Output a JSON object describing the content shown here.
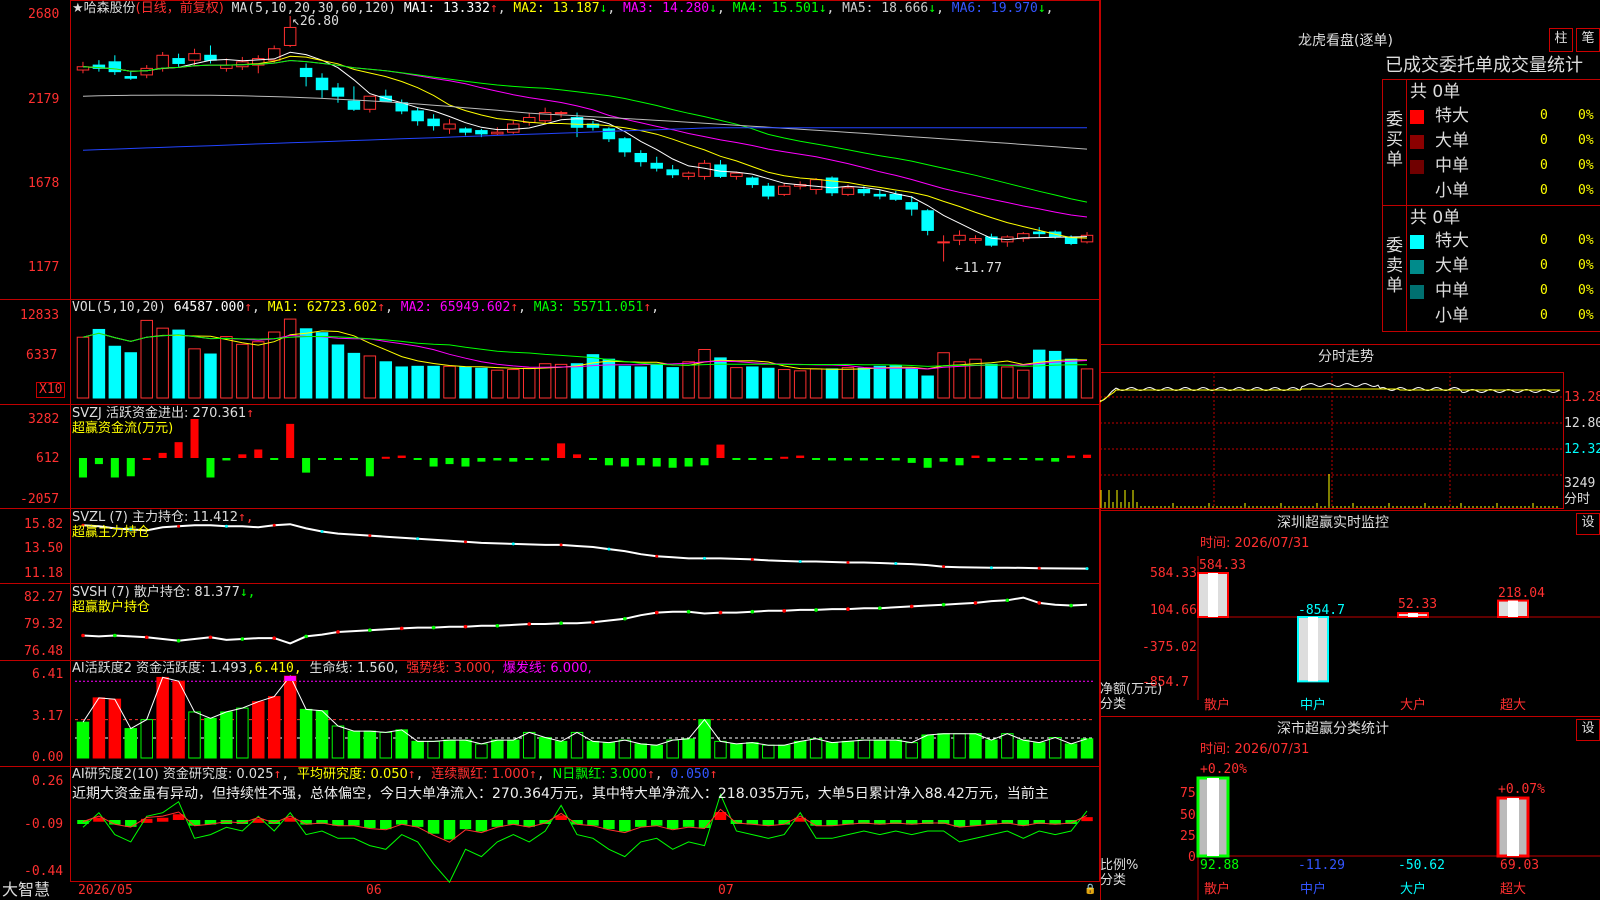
{
  "stock": {
    "star": "★",
    "name": "哈森股份",
    "period": "(日线，前复权)"
  },
  "ma_header": {
    "label": "MA(5,10,20,30,60,120)",
    "items": [
      {
        "t": "MA1: 13.332",
        "a": "↑",
        "c": "#ffffff"
      },
      {
        "t": "MA2: 13.187",
        "a": "↓",
        "c": "#ffff00"
      },
      {
        "t": "MA3: 14.280",
        "a": "↓",
        "c": "#ff00ff"
      },
      {
        "t": "MA4: 15.501",
        "a": "↓",
        "c": "#00ff00"
      },
      {
        "t": "MA5: 18.666",
        "a": "↓",
        "c": "#cccccc"
      },
      {
        "t": "MA6: 19.970",
        "a": "↓",
        "c": "#3355ff"
      }
    ]
  },
  "price_axis": [
    "2680",
    "2179",
    "1678",
    "1177"
  ],
  "price_high_label": "26.80",
  "price_low_label": "11.77",
  "vol_header": {
    "label": "VOL(5,10,20)",
    "value": "64587.000",
    "a": "↑",
    "items": [
      {
        "t": "MA1: 62723.602",
        "a": "↑",
        "c": "#ffff00"
      },
      {
        "t": "MA2: 65949.602",
        "a": "↑",
        "c": "#ff00ff"
      },
      {
        "t": "MA3: 55711.051",
        "a": "↑",
        "c": "#00ff00"
      }
    ]
  },
  "vol_axis": [
    "12833",
    "6337"
  ],
  "vol_unit": "X10",
  "svzj": {
    "label": "SVZJ  活跃资金进出: 270.361",
    "a": "↑",
    "sub": "超赢资金流(万元)",
    "axis": [
      "3282",
      "612",
      "-2057"
    ]
  },
  "svzl": {
    "label": "SVZL (7) 主力持仓: 11.412",
    "a": "↑,",
    "sub": "超赢主力持仓",
    "axis": [
      "15.82",
      "13.50",
      "11.18"
    ]
  },
  "svsh": {
    "label": "SVSH (7) 散户持仓: 81.377",
    "a": "↓,",
    "sub": "超赢散户持仓",
    "axis": [
      "82.27",
      "79.32",
      "76.48"
    ]
  },
  "ai2": {
    "label": "AI活跃度2 资金活跃度: 1.493",
    "l2": ",6.410,",
    "l3": "生命线: 1.560,",
    "l4": "强势线: 3.000,",
    "l5": "爆发线: 6.000,",
    "axis": [
      "6.41",
      "3.17",
      "0.00"
    ]
  },
  "ai_res": {
    "label": "AI研究度2(10) 资金研究度: 0.025",
    "a1": "↑",
    "l2": "平均研究度: 0.050",
    "a2": "↑",
    "l3": "连续飘红: 1.000",
    "a3": "↑",
    "l4": "N日飘红: 3.000",
    "a4": "↑",
    "l5": "0.050",
    "a5": "↑",
    "axis": [
      "0.26",
      "-0.09",
      "-0.44"
    ],
    "text": "近期大资金虽有异动，但持续性不强，总体偏空，今日大单净流入：270.364万元，其中特大单净流入：218.035万元，大单5日累计净入88.42万元，当前主"
  },
  "x_axis": [
    "2026/05",
    "06",
    "07"
  ],
  "brand": "大智慧",
  "lhb": {
    "title": "龙虎看盘(逐单)",
    "tabs": [
      "柱",
      "笔"
    ],
    "subtitle": "已成交委托单成交量统计",
    "buy": {
      "side": "委买单",
      "total": "共 0单",
      "rows": [
        [
          "特大",
          "0",
          "0%"
        ],
        [
          "大单",
          "0",
          "0%"
        ],
        [
          "中单",
          "0",
          "0%"
        ],
        [
          "小单",
          "0",
          "0%"
        ]
      ]
    },
    "sell": {
      "side": "委卖单",
      "total": "共 0单",
      "rows": [
        [
          "特大",
          "0",
          "0%"
        ],
        [
          "大单",
          "0",
          "0%"
        ],
        [
          "中单",
          "0",
          "0%"
        ],
        [
          "小单",
          "0",
          "0%"
        ]
      ]
    }
  },
  "fenshi": {
    "title": "分时走势",
    "axis": [
      "13.28",
      "12.80",
      "12.32",
      "3249"
    ],
    "unit": "分时"
  },
  "sz_monitor": {
    "title": "深圳超赢实时监控",
    "btn": "设",
    "time": "时间: 2026/07/31",
    "axis": [
      "584.33",
      "104.66",
      "-375.02",
      "-854.7"
    ],
    "bar_labels": [
      "584.33",
      "-854.7",
      "52.33",
      "218.04"
    ],
    "ylab": "净额(万元)",
    "xlab": "分类",
    "cats": [
      "散户",
      "中户",
      "大户",
      "超大"
    ]
  },
  "sz_class": {
    "title": "深市超赢分类统计",
    "btn": "设",
    "time": "时间: 2026/07/31",
    "axis": [
      "75",
      "50",
      "25",
      "0"
    ],
    "top_labels": [
      "+0.20%",
      "+0.07%"
    ],
    "vals": [
      "92.88",
      "-11.29",
      "-50.62",
      "69.03"
    ],
    "ylab": "比例%",
    "xlab": "分类",
    "cats": [
      "散户",
      "中户",
      "大户",
      "超大"
    ]
  },
  "chart_data": [
    {
      "type": "candlestick",
      "title": "哈森股份 日线 前复权",
      "ylim": [
        11.77,
        26.8
      ],
      "markers": {
        "high": 26.8,
        "low": 11.77
      },
      "ma_series": [
        {
          "name": "MA1",
          "last": 13.332
        },
        {
          "name": "MA2",
          "last": 13.187
        },
        {
          "name": "MA3",
          "last": 14.28
        },
        {
          "name": "MA4",
          "last": 15.501
        },
        {
          "name": "MA5",
          "last": 18.666
        },
        {
          "name": "MA6",
          "last": 19.97
        }
      ],
      "ohlc": [
        [
          23.5,
          24.0,
          23.3,
          23.7
        ],
        [
          23.8,
          24.1,
          23.4,
          23.6
        ],
        [
          24.0,
          24.4,
          23.2,
          23.4
        ],
        [
          23.1,
          23.4,
          22.9,
          23.0
        ],
        [
          23.2,
          23.8,
          23.0,
          23.6
        ],
        [
          23.6,
          24.6,
          23.4,
          24.4
        ],
        [
          24.2,
          24.5,
          23.7,
          23.9
        ],
        [
          24.1,
          24.8,
          23.8,
          24.5
        ],
        [
          24.4,
          25.0,
          23.9,
          24.1
        ],
        [
          23.6,
          24.2,
          23.4,
          23.8
        ],
        [
          23.7,
          24.3,
          23.5,
          24.0
        ],
        [
          23.8,
          24.4,
          23.3,
          24.2
        ],
        [
          24.1,
          25.0,
          23.9,
          24.8
        ],
        [
          25.0,
          26.8,
          24.9,
          26.1
        ],
        [
          23.6,
          23.9,
          22.5,
          23.1
        ],
        [
          23.0,
          23.3,
          21.8,
          22.3
        ],
        [
          22.4,
          22.7,
          21.5,
          21.9
        ],
        [
          21.6,
          22.5,
          21.0,
          21.1
        ],
        [
          21.1,
          21.9,
          20.9,
          21.9
        ],
        [
          21.9,
          22.3,
          21.6,
          21.6
        ],
        [
          21.5,
          21.7,
          20.8,
          21.0
        ],
        [
          21.0,
          21.2,
          20.1,
          20.4
        ],
        [
          20.5,
          20.8,
          19.8,
          20.1
        ],
        [
          19.9,
          20.5,
          19.6,
          20.2
        ],
        [
          19.9,
          20.0,
          19.5,
          19.7
        ],
        [
          19.8,
          19.9,
          19.4,
          19.6
        ],
        [
          19.6,
          20.0,
          19.5,
          19.7
        ],
        [
          19.7,
          20.4,
          19.6,
          20.2
        ],
        [
          20.3,
          20.9,
          20.1,
          20.6
        ],
        [
          20.4,
          21.2,
          20.2,
          20.9
        ],
        [
          20.9,
          21.0,
          20.6,
          20.9
        ],
        [
          20.6,
          20.9,
          19.4,
          20.0
        ],
        [
          20.2,
          20.4,
          19.8,
          20.0
        ],
        [
          19.9,
          20.0,
          19.1,
          19.3
        ],
        [
          19.3,
          19.4,
          18.2,
          18.5
        ],
        [
          18.4,
          18.6,
          17.6,
          17.9
        ],
        [
          17.8,
          18.2,
          17.3,
          17.5
        ],
        [
          17.4,
          17.7,
          16.9,
          17.1
        ],
        [
          17.0,
          17.3,
          16.8,
          17.2
        ],
        [
          17.0,
          18.0,
          16.8,
          17.8
        ],
        [
          17.7,
          18.0,
          16.9,
          17.0
        ],
        [
          17.0,
          17.3,
          16.8,
          17.2
        ],
        [
          16.9,
          17.0,
          16.3,
          16.5
        ],
        [
          16.4,
          16.6,
          15.6,
          15.8
        ],
        [
          15.9,
          16.6,
          15.8,
          16.4
        ],
        [
          16.4,
          16.7,
          16.2,
          16.5
        ],
        [
          16.2,
          16.9,
          15.9,
          16.8
        ],
        [
          16.9,
          17.0,
          15.8,
          16.0
        ],
        [
          15.9,
          16.5,
          15.8,
          16.3
        ],
        [
          16.2,
          16.4,
          15.8,
          16.0
        ],
        [
          15.9,
          16.2,
          15.6,
          15.8
        ],
        [
          15.9,
          16.1,
          15.5,
          15.6
        ],
        [
          15.4,
          15.8,
          14.6,
          15.0
        ],
        [
          14.9,
          15.0,
          13.4,
          13.7
        ],
        [
          13.0,
          13.4,
          11.8,
          13.0
        ],
        [
          13.1,
          13.7,
          12.8,
          13.4
        ],
        [
          13.1,
          13.4,
          12.9,
          13.2
        ],
        [
          13.3,
          13.5,
          12.7,
          12.8
        ],
        [
          13.0,
          13.4,
          12.7,
          13.3
        ],
        [
          13.2,
          13.6,
          13.0,
          13.5
        ],
        [
          13.6,
          13.9,
          13.3,
          13.5
        ],
        [
          13.6,
          13.7,
          13.2,
          13.3
        ],
        [
          13.3,
          13.4,
          12.8,
          12.9
        ],
        [
          13.0,
          13.6,
          12.9,
          13.4
        ]
      ]
    },
    {
      "type": "bar",
      "title": "VOL(5,10,20)",
      "unit": "X10",
      "ylim": [
        0,
        12833
      ],
      "last": 64587.0,
      "values": [
        9400,
        10600,
        8000,
        7000,
        12000,
        10800,
        10500,
        7600,
        6800,
        9500,
        8300,
        8700,
        10200,
        12200,
        10700,
        10100,
        8200,
        6900,
        6500,
        5600,
        4800,
        4900,
        4900,
        4900,
        4800,
        4600,
        4300,
        4400,
        4600,
        5300,
        5200,
        5300,
        6700,
        6000,
        4900,
        4800,
        5200,
        4700,
        5600,
        7500,
        6200,
        4700,
        4800,
        4600,
        4400,
        4200,
        4500,
        4500,
        4700,
        4600,
        4900,
        5000,
        4600,
        3400,
        7000,
        5600,
        6000,
        5200,
        4800,
        4300,
        7400,
        7200,
        6000,
        4500
      ]
    },
    {
      "type": "bar",
      "title": "SVZJ 活跃资金进出",
      "ylim": [
        -2057,
        3282
      ],
      "last": 270.361,
      "values": [
        -1600,
        -500,
        -1600,
        -1500,
        0,
        420,
        1300,
        3200,
        -1600,
        -200,
        300,
        700,
        -100,
        2800,
        -1200,
        -50,
        -50,
        -100,
        -1500,
        100,
        200,
        -50,
        -700,
        -500,
        -700,
        -300,
        -200,
        -300,
        -100,
        -200,
        1200,
        300,
        -100,
        -600,
        -700,
        -600,
        -700,
        -800,
        -700,
        -600,
        1100,
        -50,
        -50,
        -50,
        100,
        200,
        -50,
        -200,
        -200,
        -200,
        -100,
        -200,
        -400,
        -800,
        -300,
        -600,
        200,
        -300,
        -100,
        -150,
        -200,
        -300,
        200,
        270
      ]
    },
    {
      "type": "line",
      "title": "SVZL (7) 主力持仓",
      "ylim": [
        11.18,
        15.82
      ],
      "last": 11.412,
      "values": [
        15.6,
        15.5,
        15.3,
        15.2,
        15.1,
        15.4,
        15.5,
        15.6,
        15.6,
        15.5,
        15.5,
        15.4,
        15.6,
        15.7,
        15.3,
        15.0,
        14.8,
        14.7,
        14.6,
        14.5,
        14.4,
        14.3,
        14.2,
        14.1,
        14.0,
        13.9,
        13.85,
        13.8,
        13.75,
        13.7,
        13.7,
        13.6,
        13.5,
        13.3,
        13.1,
        12.8,
        12.6,
        12.5,
        12.4,
        12.4,
        12.4,
        12.35,
        12.3,
        12.2,
        12.15,
        12.1,
        12.1,
        12.05,
        12.0,
        12.0,
        11.95,
        11.9,
        11.85,
        11.75,
        11.6,
        11.55,
        11.52,
        11.5,
        11.5,
        11.48,
        11.45,
        11.43,
        11.42,
        11.41
      ]
    },
    {
      "type": "line",
      "title": "SVSH (7) 散户持仓",
      "ylim": [
        76.48,
        82.27
      ],
      "last": 81.377,
      "values": [
        77.9,
        77.8,
        77.9,
        77.8,
        77.7,
        77.5,
        77.3,
        77.5,
        77.7,
        77.4,
        77.5,
        77.6,
        77.6,
        77.0,
        77.8,
        78.0,
        78.3,
        78.4,
        78.5,
        78.6,
        78.7,
        78.8,
        78.8,
        78.9,
        78.9,
        79.0,
        79.0,
        79.1,
        79.2,
        79.2,
        79.3,
        79.3,
        79.4,
        79.6,
        79.8,
        80.2,
        80.5,
        80.6,
        80.6,
        80.4,
        80.5,
        80.5,
        80.6,
        80.7,
        80.7,
        80.8,
        80.8,
        80.9,
        80.9,
        81.0,
        81.0,
        81.1,
        81.2,
        81.3,
        81.4,
        81.5,
        81.6,
        81.8,
        81.9,
        82.2,
        81.6,
        81.4,
        81.3,
        81.38
      ]
    },
    {
      "type": "bar",
      "title": "AI活跃度2 资金活跃度",
      "ylim": [
        0,
        6.41
      ],
      "last": 1.493,
      "lines": {
        "生命线": 1.56,
        "强势线": 3.0,
        "爆发线": 6.0
      },
      "values": [
        2.8,
        4.7,
        4.6,
        2.3,
        3.0,
        6.3,
        6.0,
        3.6,
        3.1,
        3.6,
        3.9,
        4.4,
        4.8,
        6.4,
        3.8,
        3.7,
        2.5,
        2.1,
        2.1,
        2.0,
        2.2,
        1.3,
        1.3,
        1.4,
        1.4,
        1.1,
        1.4,
        1.4,
        2.0,
        1.6,
        1.3,
        2.0,
        1.3,
        1.2,
        1.4,
        1.1,
        1.0,
        1.4,
        1.5,
        3.0,
        1.3,
        1.1,
        1.2,
        1.0,
        1.0,
        1.3,
        1.5,
        1.2,
        1.3,
        1.4,
        1.4,
        1.4,
        1.2,
        1.8,
        1.9,
        1.9,
        1.9,
        1.4,
        1.9,
        1.4,
        1.2,
        1.6,
        1.1,
        1.5
      ]
    },
    {
      "type": "bar",
      "title": "AI研究度2(10) 资金研究度",
      "ylim": [
        -0.44,
        0.26
      ],
      "last": 0.025,
      "avg": 0.05,
      "values": [
        -0.02,
        0.02,
        -0.04,
        -0.06,
        0.01,
        0.02,
        0.05,
        -0.05,
        -0.04,
        -0.02,
        -0.03,
        0.01,
        -0.03,
        0.02,
        -0.04,
        -0.03,
        -0.05,
        -0.05,
        -0.07,
        -0.08,
        -0.04,
        -0.06,
        -0.12,
        -0.17,
        -0.08,
        -0.1,
        -0.06,
        -0.04,
        -0.06,
        -0.03,
        0.04,
        -0.04,
        -0.05,
        -0.08,
        -0.1,
        -0.06,
        -0.05,
        -0.08,
        -0.06,
        -0.07,
        0.07,
        -0.03,
        -0.04,
        -0.05,
        -0.04,
        0.02,
        -0.05,
        -0.05,
        -0.04,
        -0.03,
        -0.04,
        -0.03,
        -0.04,
        -0.03,
        -0.03,
        -0.06,
        -0.05,
        -0.04,
        -0.03,
        -0.05,
        -0.03,
        -0.04,
        -0.03,
        0.025
      ]
    }
  ]
}
